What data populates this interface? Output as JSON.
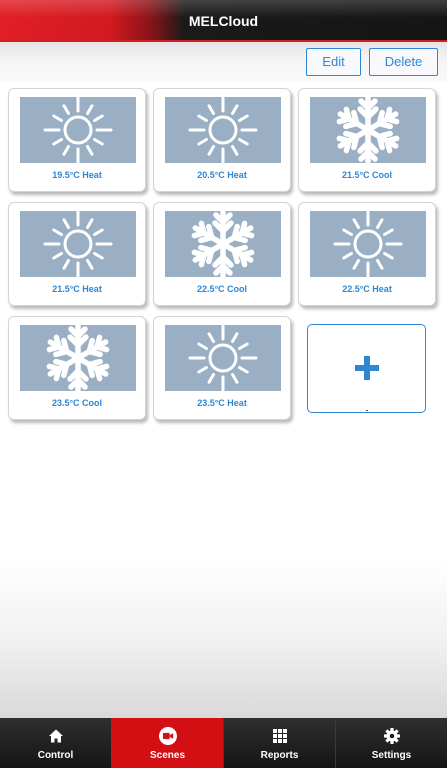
{
  "header": {
    "title": "MELCloud"
  },
  "toolbar": {
    "edit_label": "Edit",
    "delete_label": "Delete"
  },
  "scenes": [
    {
      "label": "19.5°C Heat",
      "mode": "heat",
      "icon": "sun-icon"
    },
    {
      "label": "20.5°C Heat",
      "mode": "heat",
      "icon": "sun-icon"
    },
    {
      "label": "21.5°C Cool",
      "mode": "cool",
      "icon": "snowflake-icon"
    },
    {
      "label": "21.5°C Heat",
      "mode": "heat",
      "icon": "sun-icon"
    },
    {
      "label": "22.5°C Cool",
      "mode": "cool",
      "icon": "snowflake-icon"
    },
    {
      "label": "22.5°C Heat",
      "mode": "heat",
      "icon": "sun-icon"
    },
    {
      "label": "23.5°C Cool",
      "mode": "cool",
      "icon": "snowflake-icon"
    },
    {
      "label": "23.5°C Heat",
      "mode": "heat",
      "icon": "sun-icon"
    }
  ],
  "add_scene": {
    "icon": "plus-icon"
  },
  "tabs": [
    {
      "label": "Control",
      "icon": "home-icon",
      "active": false
    },
    {
      "label": "Scenes",
      "icon": "video-icon",
      "active": true
    },
    {
      "label": "Reports",
      "icon": "grid-icon",
      "active": false
    },
    {
      "label": "Settings",
      "icon": "gear-icon",
      "active": false
    }
  ],
  "colors": {
    "accent": "#2e86d4",
    "brand_red": "#d40f14",
    "thumb_bg": "#9aafc4"
  }
}
